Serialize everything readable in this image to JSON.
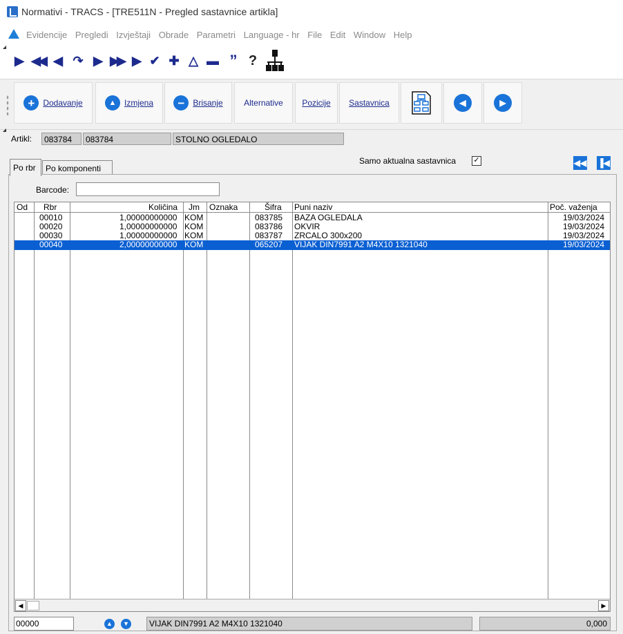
{
  "window": {
    "title": "Normativi - TRACS - [TRE511N - Pregled sastavnice artikla]"
  },
  "menu": {
    "items": [
      "Evidencije",
      "Pregledi",
      "Izvještaji",
      "Obrade",
      "Parametri",
      "Language - hr",
      "File",
      "Edit",
      "Window",
      "Help"
    ]
  },
  "nav_toolbar": {
    "icons": [
      "first-record-icon",
      "prev-page-icon",
      "prev-record-icon",
      "refresh-icon",
      "next-record-icon",
      "next-page-icon",
      "last-record-icon",
      "confirm-check-icon",
      "add-plus-icon",
      "edit-triangle-icon",
      "delete-minus-icon",
      "quote-icon",
      "help-question-icon",
      "hierarchy-tree-icon"
    ],
    "glyphs": [
      "▶",
      "◀◀",
      "◀",
      "↷",
      "▶",
      "▶▶",
      "▶",
      "✔",
      "✚",
      "△",
      "▬",
      "”",
      "?",
      "☷"
    ]
  },
  "actions": {
    "dodavanje": "Dodavanje",
    "izmjena": "Izmjena",
    "brisanje": "Brisanje",
    "alternative": "Alternative",
    "pozicije": "Pozicije",
    "sastavnica": "Sastavnica"
  },
  "form": {
    "artikl_label": "Artikl:",
    "artikl_code1": "083784",
    "artikl_code2": "083784",
    "artikl_name": "STOLNO OGLEDALO",
    "samo_aktualna_label": "Samo aktualna sastavnica",
    "samo_aktualna_checked": "✓",
    "barcode_label": "Barcode:",
    "barcode_value": ""
  },
  "tabs": [
    "Po rbr",
    "Po komponenti"
  ],
  "grid": {
    "columns": [
      "Od",
      "Rbr",
      "Količina",
      "Jm",
      "Oznaka",
      "Šifra",
      "Puni naziv",
      "Poč. važenja"
    ],
    "rows": [
      {
        "od": "",
        "rbr": "00010",
        "kolicina": "1,00000000000",
        "jm": "KOM",
        "oznaka": "",
        "sifra": "083785",
        "naziv": "BAZA OGLEDALA",
        "pocetak": "19/03/2024"
      },
      {
        "od": "",
        "rbr": "00020",
        "kolicina": "1,00000000000",
        "jm": "KOM",
        "oznaka": "",
        "sifra": "083786",
        "naziv": "OKVIR",
        "pocetak": "19/03/2024"
      },
      {
        "od": "",
        "rbr": "00030",
        "kolicina": "1,00000000000",
        "jm": "KOM",
        "oznaka": "",
        "sifra": "083787",
        "naziv": "ZRCALO 300x200",
        "pocetak": "19/03/2024"
      },
      {
        "od": "",
        "rbr": "00040",
        "kolicina": "2,00000000000",
        "jm": "KOM",
        "oznaka": "",
        "sifra": "065207",
        "naziv": "VIJAK DIN7991 A2 M4X10  1321040",
        "pocetak": "19/03/2024"
      }
    ],
    "selected_row": 3
  },
  "status": {
    "input_value": "00000",
    "description": "VIJAK DIN7991 A2 M4X10  1321040",
    "number": "0,000"
  },
  "colors": {
    "accent": "#1a73d8",
    "selection": "#0a5fd2",
    "nav_icon": "#1c2a8e"
  }
}
